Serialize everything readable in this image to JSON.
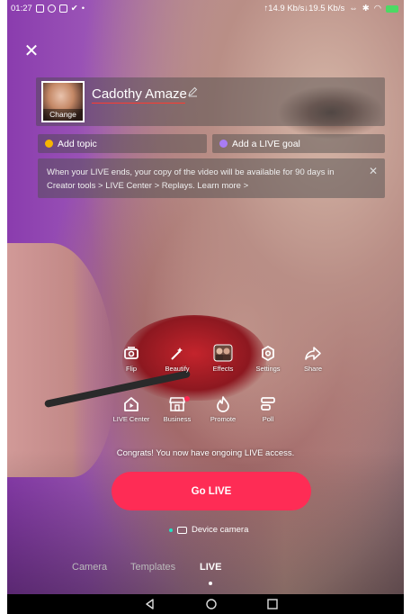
{
  "status_bar": {
    "time": "01:27",
    "network_speed": "↑14.9 Kb/s↓19.5 Kb/s"
  },
  "header": {
    "cover_change_label": "Change",
    "title": "Cadothy Amaze"
  },
  "topic": {
    "label": "Add topic"
  },
  "goal": {
    "label": "Add a LIVE goal"
  },
  "notice": {
    "text": "When your LIVE ends, your copy of the video will be available for 90 days in Creator tools > LIVE Center > Replays. Learn more >"
  },
  "tools_row1": [
    {
      "label": "Flip",
      "icon": "flip-camera-icon"
    },
    {
      "label": "Beautify",
      "icon": "beautify-wand-icon"
    },
    {
      "label": "Effects",
      "icon": "effects-thumbnail-icon"
    },
    {
      "label": "Settings",
      "icon": "gear-icon"
    },
    {
      "label": "Share",
      "icon": "share-arrow-icon"
    }
  ],
  "tools_row2": [
    {
      "label": "LIVE Center",
      "icon": "live-center-icon"
    },
    {
      "label": "Business",
      "icon": "storefront-icon",
      "badge": true
    },
    {
      "label": "Promote",
      "icon": "flame-icon"
    },
    {
      "label": "Poll",
      "icon": "poll-icon"
    }
  ],
  "congrats": "Congrats! You now have ongoing LIVE access.",
  "go_live_label": "Go LIVE",
  "source": {
    "label": "Device camera"
  },
  "modes": [
    {
      "label": "Camera"
    },
    {
      "label": "Templates"
    },
    {
      "label": "LIVE",
      "active": true
    }
  ],
  "colors": {
    "accent": "#fe2c55",
    "status_dot": "#21e3c3"
  }
}
